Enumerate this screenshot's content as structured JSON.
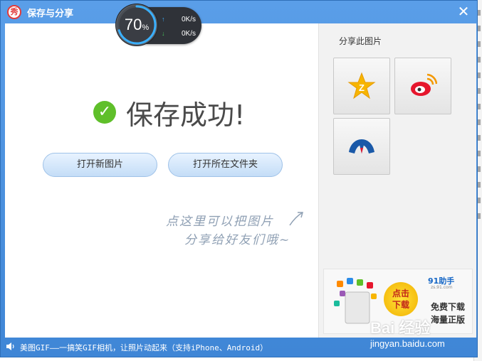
{
  "window": {
    "title": "保存与分享",
    "app_logo": "秀",
    "close_label": "✕"
  },
  "speed_widget": {
    "percent": "70",
    "percent_unit": "%",
    "percent_value": 70,
    "upload": "0K/s",
    "download": "0K/s"
  },
  "main": {
    "success_text": "保存成功!",
    "open_new_label": "打开新图片",
    "open_folder_label": "打开所在文件夹",
    "hint_line1": "点这里可以把图片",
    "hint_line2": "分享给好友们哦~"
  },
  "share": {
    "title": "分享此图片",
    "targets": [
      "qzone-icon",
      "weibo-icon",
      "renren-icon"
    ]
  },
  "ad": {
    "click_line1": "点击",
    "click_line2": "下载",
    "brand": "91助手",
    "brand_url": "zs.91.com",
    "line1": "免费下载",
    "line2": "海量正版"
  },
  "statusbar": {
    "text": "美图GIF——一搞笑GIF相机，让照片动起来（支持iPhone、Android）"
  },
  "watermark": {
    "logo": "Bai 经验",
    "url": "jingyan.baidu.com"
  },
  "colors": {
    "title_bar": "#4a92e0",
    "success_green": "#5fbf2a",
    "button_blue": "#c4ddf7"
  }
}
